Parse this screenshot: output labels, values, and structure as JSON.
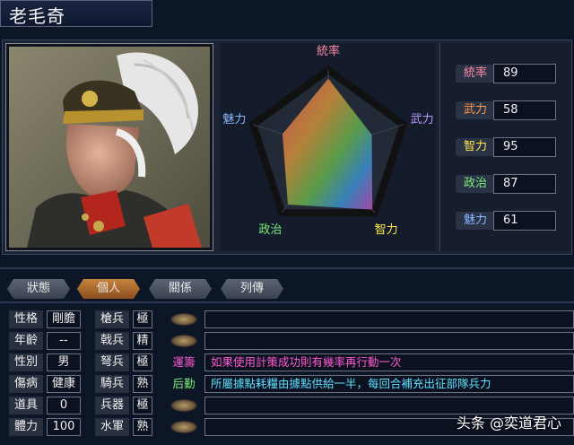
{
  "officer": {
    "name": "老毛奇"
  },
  "radar": {
    "labels": {
      "command": "統率",
      "war": "武力",
      "intel": "智力",
      "politics": "政治",
      "charm": "魅力"
    },
    "values": {
      "command": 89,
      "war": 58,
      "intel": 95,
      "politics": 87,
      "charm": 61
    }
  },
  "stats": [
    {
      "label": "統率",
      "value": "89",
      "color": "#ff8aa8"
    },
    {
      "label": "武力",
      "value": "58",
      "color": "#ff9a4a"
    },
    {
      "label": "智力",
      "value": "95",
      "color": "#ffe84a"
    },
    {
      "label": "政治",
      "value": "87",
      "color": "#7cf07c"
    },
    {
      "label": "魅力",
      "value": "61",
      "color": "#8ab8ff"
    }
  ],
  "tabs": [
    {
      "label": "狀態",
      "active": false
    },
    {
      "label": "個人",
      "active": true
    },
    {
      "label": "關係",
      "active": false
    },
    {
      "label": "列傳",
      "active": false
    }
  ],
  "personal": [
    {
      "label": "性格",
      "value": "剛膽"
    },
    {
      "label": "年齡",
      "value": "--"
    },
    {
      "label": "性別",
      "value": "男"
    },
    {
      "label": "傷病",
      "value": "健康"
    },
    {
      "label": "道具",
      "value": "0"
    },
    {
      "label": "體力",
      "value": "100"
    }
  ],
  "aptitude": [
    {
      "label": "槍兵",
      "value": "極"
    },
    {
      "label": "戟兵",
      "value": "精"
    },
    {
      "label": "弩兵",
      "value": "極"
    },
    {
      "label": "騎兵",
      "value": "熟"
    },
    {
      "label": "兵器",
      "value": "極"
    },
    {
      "label": "水軍",
      "value": "熟"
    }
  ],
  "skills": [
    {
      "name": "",
      "desc": ""
    },
    {
      "name": "",
      "desc": ""
    },
    {
      "name": "運籌",
      "desc": "如果使用計策成功則有幾率再行動一次",
      "name_color": "#ff5ad0",
      "desc_color": "#ff5ad0"
    },
    {
      "name": "后勤",
      "desc": "所屬據點耗糧由據點供給一半，每回合補充出征部隊兵力",
      "name_color": "#7cf07c",
      "desc_color": "#5fe0ff"
    },
    {
      "name": "",
      "desc": ""
    },
    {
      "name": "",
      "desc": ""
    }
  ],
  "watermark": "头条 @奕道君心",
  "colors": {
    "radar_outline": "#1c1c1c",
    "bg": "#0d1626"
  }
}
